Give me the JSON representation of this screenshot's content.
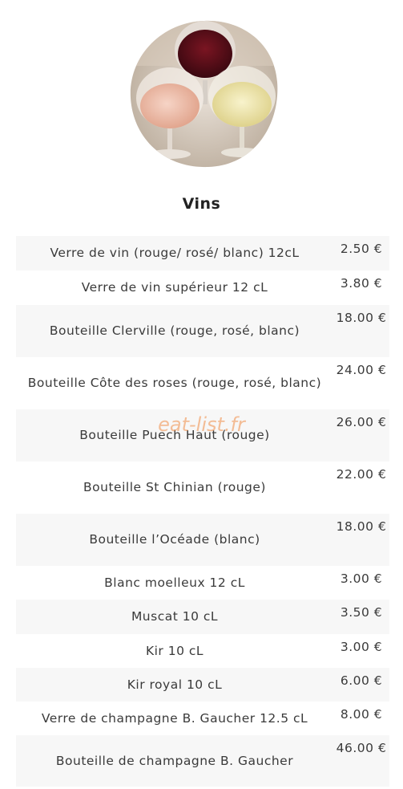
{
  "section": {
    "title": "Vins"
  },
  "watermark": "eat-list.fr",
  "hero": {
    "image": "wine-glasses-image"
  },
  "items": [
    {
      "name": "Verre de vin (rouge/ rosé/ blanc) 12cL",
      "price": "2.50 €"
    },
    {
      "name": "Verre de vin supérieur 12 cL",
      "price": "3.80 €"
    },
    {
      "name": "Bouteille Clerville (rouge, rosé, blanc)",
      "price": "18.00 €"
    },
    {
      "name": "Bouteille Côte des roses (rouge, rosé, blanc)",
      "price": "24.00 €"
    },
    {
      "name": "Bouteille Puech Haut (rouge)",
      "price": "26.00 €"
    },
    {
      "name": "Bouteille St Chinian (rouge)",
      "price": "22.00 €"
    },
    {
      "name": "Bouteille l’Océade (blanc)",
      "price": "18.00 €"
    },
    {
      "name": "Blanc moelleux 12 cL",
      "price": "3.00 €"
    },
    {
      "name": "Muscat 10 cL",
      "price": "3.50 €"
    },
    {
      "name": "Kir 10 cL",
      "price": "3.00 €"
    },
    {
      "name": "Kir royal 10 cL",
      "price": "6.00 €"
    },
    {
      "name": "Verre de champagne B. Gaucher 12.5 cL",
      "price": "8.00 €"
    },
    {
      "name": "Bouteille de champagne B. Gaucher",
      "price": "46.00 €"
    }
  ]
}
